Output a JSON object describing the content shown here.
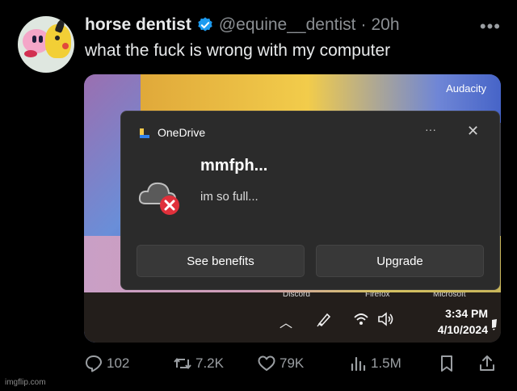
{
  "post": {
    "display_name": "horse dentist",
    "handle": "@equine__dentist",
    "separator": "·",
    "time": "20h",
    "text": "what the fuck is wrong with my computer"
  },
  "screenshot": {
    "top_app_label": "Audacity",
    "notification": {
      "app_name": "OneDrive",
      "more": "···",
      "close": "✕",
      "title": "mmfph...",
      "body": "im so full...",
      "buttons": [
        "See benefits",
        "Upgrade"
      ]
    },
    "taskbar_labels": [
      "Discord",
      "Firefox",
      "Microsoft"
    ],
    "tray": {
      "time": "3:34 PM",
      "date": "4/10/2024"
    }
  },
  "actions": {
    "replies": "102",
    "reposts": "7.2K",
    "likes": "79K",
    "views": "1.5M"
  },
  "icons": [
    "verified-badge-icon",
    "more-options-icon",
    "onedrive-icon",
    "cloud-error-icon",
    "close-icon",
    "chevron-up-icon",
    "pen-icon",
    "wifi-icon",
    "volume-icon",
    "reply-icon",
    "repost-icon",
    "like-icon",
    "views-icon",
    "bookmark-icon",
    "share-icon"
  ],
  "colors": {
    "background": "#000000",
    "verified": "#1d9bf0",
    "error": "#e0303b"
  },
  "watermark": "imgflip.com"
}
